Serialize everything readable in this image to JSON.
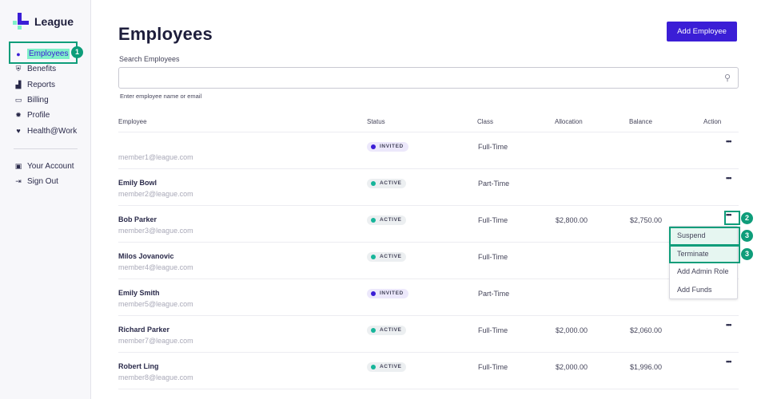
{
  "app": {
    "logo_text": "League"
  },
  "sidebar": {
    "items": [
      {
        "label": "Employees",
        "icon": "person-icon",
        "glyph": "👤",
        "active": true
      },
      {
        "label": "Benefits",
        "icon": "shield-icon",
        "glyph": "⛨"
      },
      {
        "label": "Reports",
        "icon": "chart-icon",
        "glyph": "▟"
      },
      {
        "label": "Billing",
        "icon": "credit-card-icon",
        "glyph": "▭"
      },
      {
        "label": "Profile",
        "icon": "gear-icon",
        "glyph": "✹"
      },
      {
        "label": "Health@Work",
        "icon": "heart-icon",
        "glyph": "♥"
      }
    ],
    "secondary": [
      {
        "label": "Your Account",
        "icon": "id-card-icon",
        "glyph": "▣"
      },
      {
        "label": "Sign Out",
        "icon": "sign-out-icon",
        "glyph": "⇥"
      }
    ]
  },
  "header": {
    "title": "Employees",
    "add_button": "Add Employee"
  },
  "search": {
    "label": "Search Employees",
    "value": "",
    "placeholder": "",
    "hint": "Enter employee name or email"
  },
  "table": {
    "columns": [
      "Employee",
      "Status",
      "Class",
      "Allocation",
      "Balance",
      "Action"
    ],
    "rows": [
      {
        "name": "",
        "email": "member1@league.com",
        "status": "INVITED",
        "status_type": "invited",
        "class": "Full-Time",
        "allocation": "",
        "balance": "",
        "action": "•••"
      },
      {
        "name": "Emily Bowl",
        "email": "member2@league.com",
        "status": "ACTIVE",
        "status_type": "active",
        "class": "Part-Time",
        "allocation": "",
        "balance": "",
        "action": "•••"
      },
      {
        "name": "Bob Parker",
        "email": "member3@league.com",
        "status": "ACTIVE",
        "status_type": "active",
        "class": "Full-Time",
        "allocation": "$2,800.00",
        "balance": "$2,750.00",
        "action": "•••"
      },
      {
        "name": "Milos Jovanovic",
        "email": "member4@league.com",
        "status": "ACTIVE",
        "status_type": "active",
        "class": "Full-Time",
        "allocation": "",
        "balance": "",
        "action": ""
      },
      {
        "name": "Emily Smith",
        "email": "member5@league.com",
        "status": "INVITED",
        "status_type": "invited",
        "class": "Part-Time",
        "allocation": "",
        "balance": "",
        "action": ""
      },
      {
        "name": "Richard Parker",
        "email": "member7@league.com",
        "status": "ACTIVE",
        "status_type": "active",
        "class": "Full-Time",
        "allocation": "$2,000.00",
        "balance": "$2,060.00",
        "action": "•••"
      },
      {
        "name": "Robert Ling",
        "email": "member8@league.com",
        "status": "ACTIVE",
        "status_type": "active",
        "class": "Full-Time",
        "allocation": "$2,000.00",
        "balance": "$1,996.00",
        "action": "•••"
      }
    ]
  },
  "action_menu": {
    "items": [
      {
        "label": "Suspend",
        "highlighted": true
      },
      {
        "label": "Terminate",
        "highlighted": true
      },
      {
        "label": "Add Admin Role",
        "highlighted": false
      },
      {
        "label": "Add Funds",
        "highlighted": false
      }
    ]
  },
  "annotations": [
    {
      "label": "1",
      "target": "Employees nav item"
    },
    {
      "label": "2",
      "target": "Bob Parker action button"
    },
    {
      "label": "3",
      "target": "Suspend"
    },
    {
      "label": "3",
      "target": "Terminate"
    }
  ],
  "colors": {
    "brand": "#3b1ed6",
    "accent": "#7ff0c9",
    "annotation": "#0e9d7a",
    "active_dot": "#17b59a"
  }
}
